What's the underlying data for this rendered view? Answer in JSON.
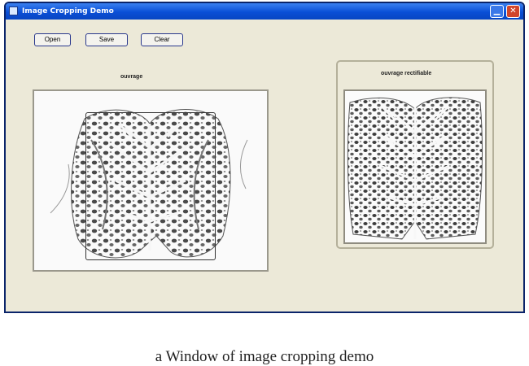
{
  "window": {
    "title": "Image Cropping Demo",
    "icon": "app-window-icon",
    "controls": {
      "minimize_icon": "minimize-icon",
      "close_icon": "close-icon"
    }
  },
  "toolbar": {
    "open_label": "Open",
    "save_label": "Save",
    "clear_label": "Clear"
  },
  "panels": {
    "original_label": "ouvrage",
    "cropped_label": "ouvrage rectifiable"
  },
  "figure": {
    "caption": "a  Window of image cropping demo"
  },
  "colors": {
    "titlebar": "#0a4fd6",
    "window_bg": "#ece9d8",
    "close_button": "#d2452a"
  }
}
